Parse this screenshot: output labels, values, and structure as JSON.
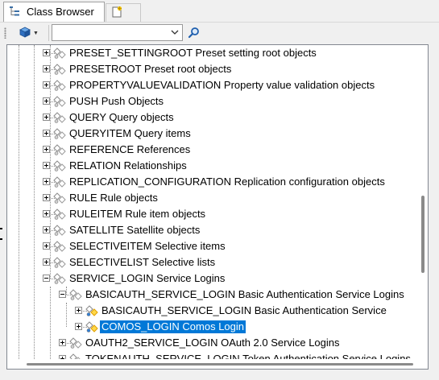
{
  "tabs": [
    {
      "label": "Class Browser",
      "icon": "class-tree-icon",
      "active": true
    },
    {
      "label": "",
      "icon": "new-document-icon",
      "active": false
    }
  ],
  "toolbar": {
    "object_type_button_icon": "blue-cube-icon",
    "search_value": "",
    "search_placeholder": "",
    "search_button_icon": "magnifier-icon"
  },
  "tree": {
    "rows": [
      {
        "label": "PRESET_SETTINGROOT Preset setting root objects",
        "expander": "plus"
      },
      {
        "label": "PRESETROOT Preset root objects",
        "expander": "plus"
      },
      {
        "label": "PROPERTYVALUEVALIDATION Property value validation objects",
        "expander": "plus"
      },
      {
        "label": "PUSH Push Objects",
        "expander": "plus"
      },
      {
        "label": "QUERY Query objects",
        "expander": "plus"
      },
      {
        "label": "QUERYITEM Query items",
        "expander": "plus"
      },
      {
        "label": "REFERENCE References",
        "expander": "plus"
      },
      {
        "label": "RELATION Relationships",
        "expander": "plus"
      },
      {
        "label": "REPLICATION_CONFIGURATION Replication configuration objects",
        "expander": "plus"
      },
      {
        "label": "RULE Rule objects",
        "expander": "plus"
      },
      {
        "label": "RULEITEM Rule item objects",
        "expander": "plus"
      },
      {
        "label": "SATELLITE Satellite objects",
        "expander": "plus"
      },
      {
        "label": "SELECTIVEITEM Selective items",
        "expander": "plus"
      },
      {
        "label": "SELECTIVELIST Selective lists",
        "expander": "plus"
      },
      {
        "label": "SERVICE_LOGIN Service Logins",
        "expander": "minus"
      },
      {
        "label": "BASICAUTH_SERVICE_LOGIN Basic Authentication Service Logins",
        "expander": "minus"
      },
      {
        "label": "BASICAUTH_SERVICE_LOGIN Basic Authentication Service",
        "expander": "plus"
      },
      {
        "label": "COMOS_LOGIN Comos Login",
        "expander": "plus",
        "selected": true
      },
      {
        "label": "OAUTH2_SERVICE_LOGIN OAuth 2.0 Service Logins",
        "expander": "plus"
      },
      {
        "label": "TOKENAUTH_SERVICE_LOGIN Token Authentication Service Logins",
        "expander": "plus"
      }
    ]
  },
  "colors": {
    "selection": "#0078d7",
    "panel_background": "#f0f0f0",
    "tree_background": "#ffffff"
  }
}
